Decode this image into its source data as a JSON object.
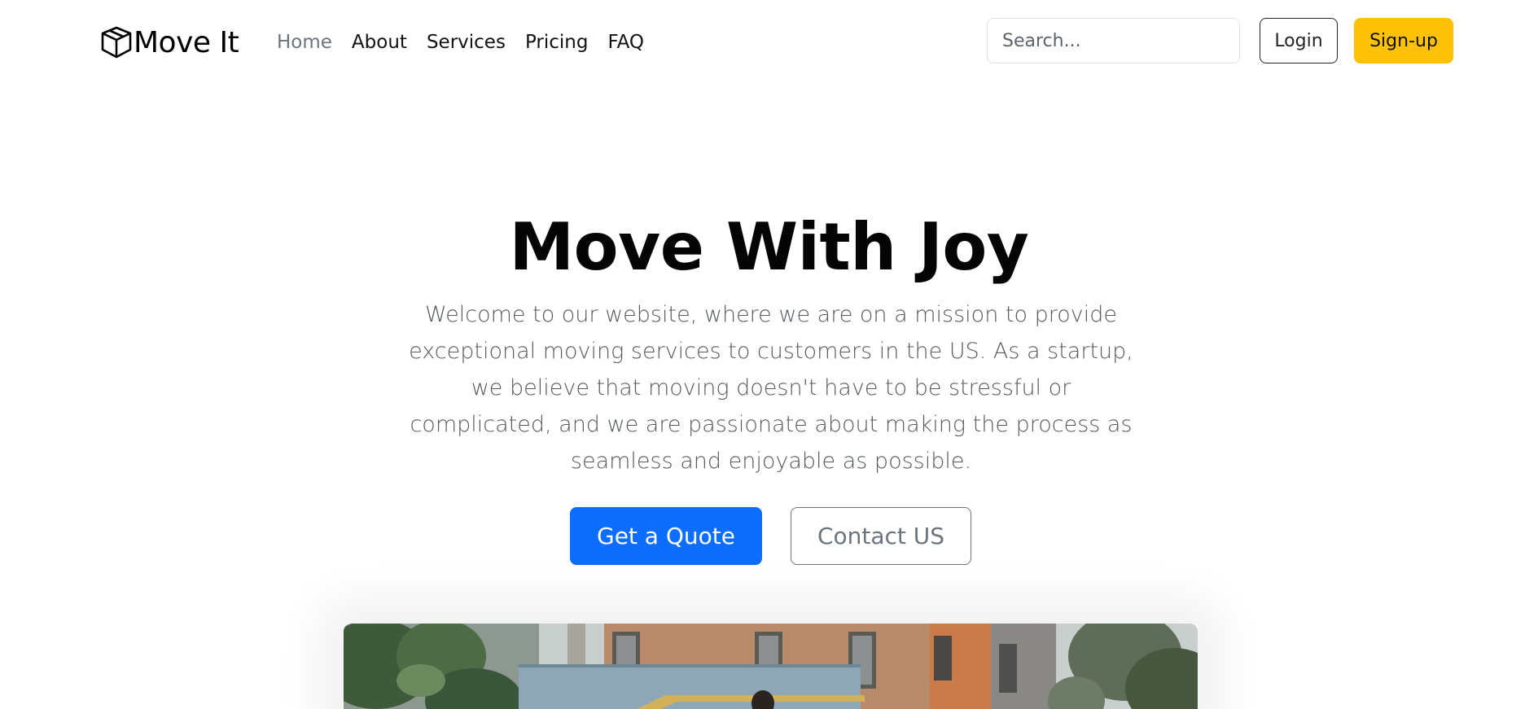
{
  "brand": {
    "name": "Move It",
    "icon": "box-icon"
  },
  "nav": {
    "items": [
      {
        "label": "Home",
        "active": true
      },
      {
        "label": "About",
        "active": false
      },
      {
        "label": "Services",
        "active": false
      },
      {
        "label": "Pricing",
        "active": false
      },
      {
        "label": "FAQ",
        "active": false
      }
    ]
  },
  "search": {
    "placeholder": "Search...",
    "value": ""
  },
  "auth": {
    "login_label": "Login",
    "signup_label": "Sign-up"
  },
  "hero": {
    "title": "Move With Joy",
    "text": "Welcome to our website, where we are on a mission to provide exceptional moving services to customers in the US. As a startup, we believe that moving doesn't have to be stressful or complicated, and we are passionate about making the process as seamless and enjoyable as possible.",
    "primary_cta": "Get a Quote",
    "secondary_cta": "Contact US"
  },
  "colors": {
    "primary": "#0d6efd",
    "warning": "#ffc107",
    "muted": "#6c757d"
  }
}
